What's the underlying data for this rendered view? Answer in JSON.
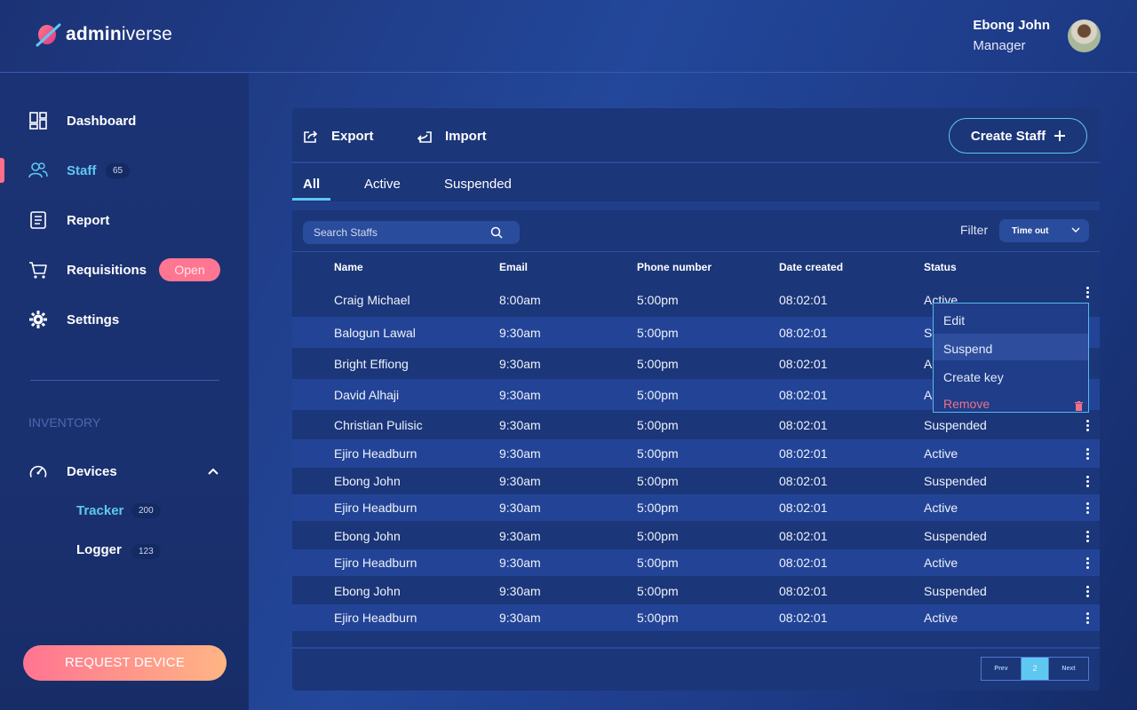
{
  "brand": {
    "bold": "admin",
    "light": "iverse"
  },
  "user": {
    "name": "Ebong John",
    "role": "Manager"
  },
  "sidebar": {
    "items": [
      {
        "label": "Dashboard",
        "icon": "dashboard-icon"
      },
      {
        "label": "Staff",
        "icon": "users-icon",
        "count": "65",
        "active": true
      },
      {
        "label": "Report",
        "icon": "report-icon"
      },
      {
        "label": "Requisitions",
        "icon": "cart-icon",
        "badge": "Open"
      },
      {
        "label": "Settings",
        "icon": "gear-icon"
      }
    ],
    "section_label": "INVENTORY",
    "devices": {
      "label": "Devices",
      "icon": "gauge-icon"
    },
    "sub_items": [
      {
        "label": "Tracker",
        "count": "200"
      },
      {
        "label": "Logger",
        "count": "123"
      }
    ],
    "request_button": "REQUEST DEVICE"
  },
  "toolbar": {
    "export_label": "Export",
    "import_label": "Import",
    "create_label": "Create Staff"
  },
  "tabs": [
    "All",
    "Active",
    "Suspended"
  ],
  "search": {
    "placeholder": "Search Staffs"
  },
  "filter": {
    "label": "Filter",
    "value": "Time out"
  },
  "table": {
    "headers": [
      "Name",
      "Email",
      "Phone number",
      "Date created",
      "Status"
    ],
    "rows": [
      [
        "Craig Michael",
        "8:00am",
        "5:00pm",
        "08:02:01",
        "Active"
      ],
      [
        "Balogun Lawal",
        "9:30am",
        "5:00pm",
        "08:02:01",
        "Suspended"
      ],
      [
        "Bright Effiong",
        "9:30am",
        "5:00pm",
        "08:02:01",
        "Active"
      ],
      [
        "David Alhaji",
        "9:30am",
        "5:00pm",
        "08:02:01",
        "Active"
      ],
      [
        "Christian Pulisic",
        "9:30am",
        "5:00pm",
        "08:02:01",
        "Suspended"
      ],
      [
        "Ejiro Headburn",
        "9:30am",
        "5:00pm",
        "08:02:01",
        "Active"
      ],
      [
        "Ebong John",
        "9:30am",
        "5:00pm",
        "08:02:01",
        "Suspended"
      ],
      [
        "Ejiro Headburn",
        "9:30am",
        "5:00pm",
        "08:02:01",
        "Active"
      ],
      [
        "Ebong John",
        "9:30am",
        "5:00pm",
        "08:02:01",
        "Suspended"
      ],
      [
        "Ejiro Headburn",
        "9:30am",
        "5:00pm",
        "08:02:01",
        "Active"
      ],
      [
        "Ebong John",
        "9:30am",
        "5:00pm",
        "08:02:01",
        "Suspended"
      ],
      [
        "Ejiro Headburn",
        "9:30am",
        "5:00pm",
        "08:02:01",
        "Active"
      ]
    ]
  },
  "context_menu": [
    "Edit",
    "Suspend",
    "Create key",
    "Remove"
  ],
  "pagination": {
    "prev": "Prev",
    "current": "2",
    "next": "Next"
  },
  "colors": {
    "accent": "#5fc8f0",
    "pink": "#ff7692",
    "card": "#1b3679"
  }
}
